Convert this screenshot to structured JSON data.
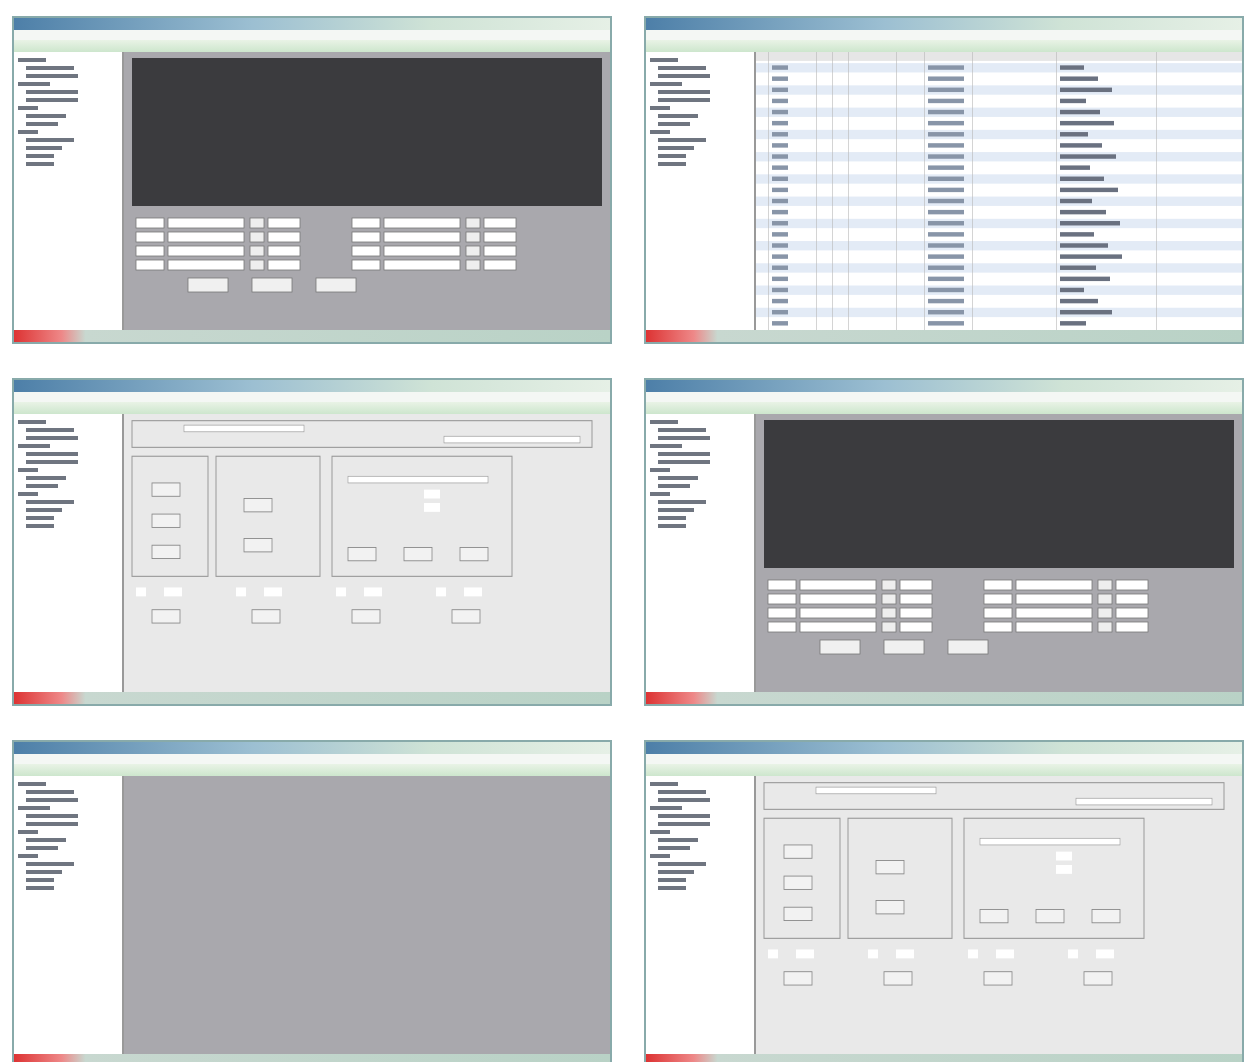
{
  "screenshots": [
    {
      "kind": "monitor"
    },
    {
      "kind": "table"
    },
    {
      "kind": "modes"
    },
    {
      "kind": "monitor"
    },
    {
      "kind": "blank"
    },
    {
      "kind": "modes"
    }
  ]
}
